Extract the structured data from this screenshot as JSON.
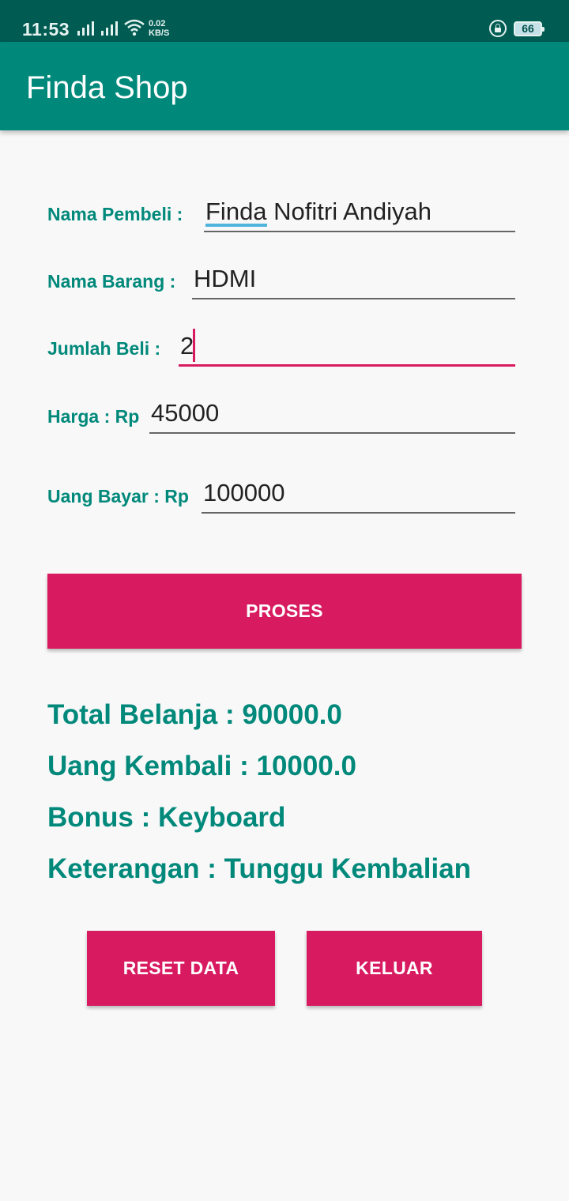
{
  "status_bar": {
    "time": "11:53",
    "speed_value": "0.02",
    "speed_unit": "KB/S",
    "battery": "66",
    "icons": [
      "signal-icon",
      "signal-icon",
      "wifi-icon",
      "lock-rotation-icon",
      "battery-icon"
    ]
  },
  "app_bar": {
    "title": "Finda Shop"
  },
  "form": {
    "nama_pembeli": {
      "label": "Nama Pembeli :",
      "value": "Finda Nofitri Andiyah"
    },
    "nama_barang": {
      "label": "Nama Barang :",
      "value": "HDMI"
    },
    "jumlah_beli": {
      "label": "Jumlah Beli :",
      "value": "2"
    },
    "harga": {
      "label": "Harga : Rp",
      "value": "45000"
    },
    "uang_bayar": {
      "label": "Uang Bayar : Rp",
      "value": "100000"
    }
  },
  "buttons": {
    "proses": "PROSES",
    "reset": "RESET DATA",
    "keluar": "KELUAR"
  },
  "results": {
    "total": "Total Belanja : 90000.0",
    "kembali": "Uang Kembali : 10000.0",
    "bonus": "Bonus : Keyboard",
    "keterangan": "Keterangan : Tunggu Kembalian"
  },
  "colors": {
    "primary": "#00897b",
    "primary_dark": "#005c52",
    "accent": "#d81b60"
  }
}
